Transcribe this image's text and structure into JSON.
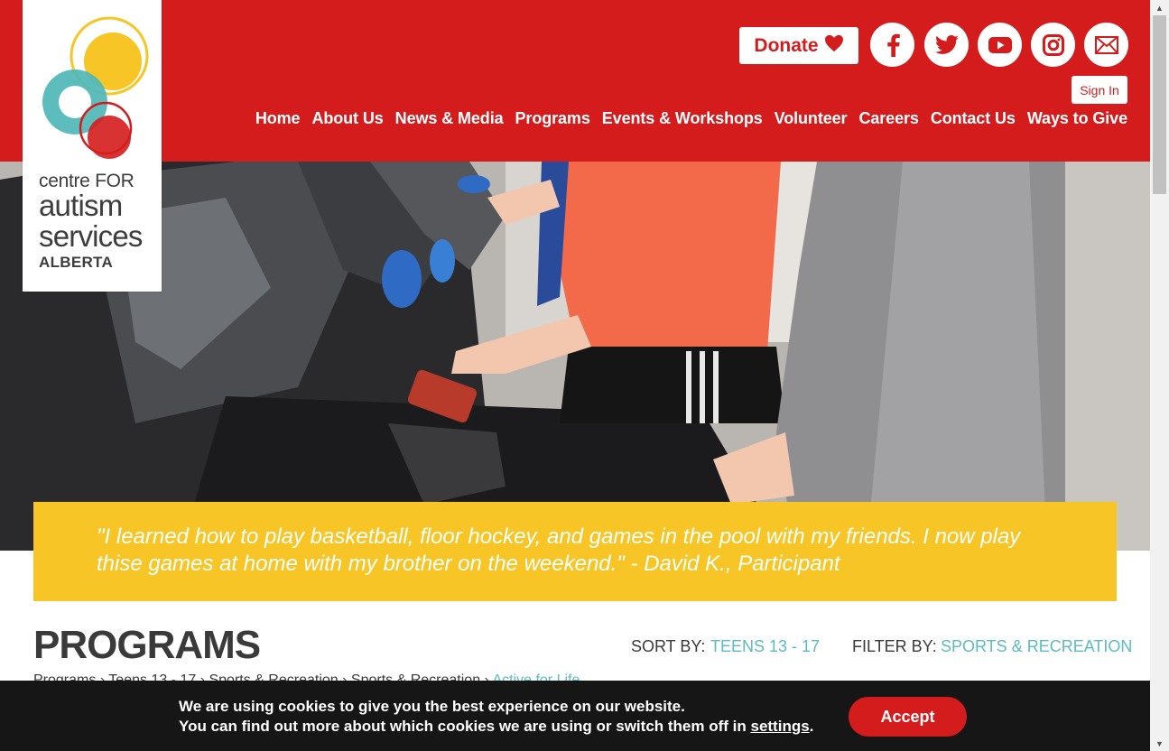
{
  "logo": {
    "line1": "centre FOR",
    "line2": "autism",
    "line3": "services",
    "line4": "ALBERTA"
  },
  "header": {
    "donate_label": "Donate",
    "signin_label": "Sign In",
    "social_icons": [
      "facebook-icon",
      "twitter-icon",
      "youtube-icon",
      "instagram-icon",
      "email-icon"
    ],
    "nav": [
      "Home",
      "About Us",
      "News & Media",
      "Programs",
      "Events & Workshops",
      "Volunteer",
      "Careers",
      "Contact Us",
      "Ways to Give"
    ]
  },
  "hero": {
    "quote": "\"I learned how to play basketball, floor hockey, and games in the pool with my friends. I now play thise games at home with my brother on the weekend.\" - David K., Participant"
  },
  "programs": {
    "title": "PROGRAMS",
    "sort_label": "SORT BY:",
    "sort_value": "TEENS 13 - 17",
    "filter_label": "FILTER BY:",
    "filter_value": "SPORTS & RECREATION",
    "breadcrumb": [
      "Programs",
      "Teens 13 - 17",
      "Sports & Recreation",
      "Sports & Recreation"
    ],
    "breadcrumb_active": "Active for Life"
  },
  "cookie": {
    "line1": "We are using cookies to give you the best experience on our website.",
    "line2_prefix": "You can find out more about which cookies we are using or switch them off in ",
    "settings_link": "settings",
    "line2_suffix": ".",
    "accept_label": "Accept"
  },
  "colors": {
    "brand_red": "#d51c1d",
    "quote_yellow": "#f7c626",
    "accent_teal": "#5bbcc0",
    "cookie_bg": "#161616"
  }
}
